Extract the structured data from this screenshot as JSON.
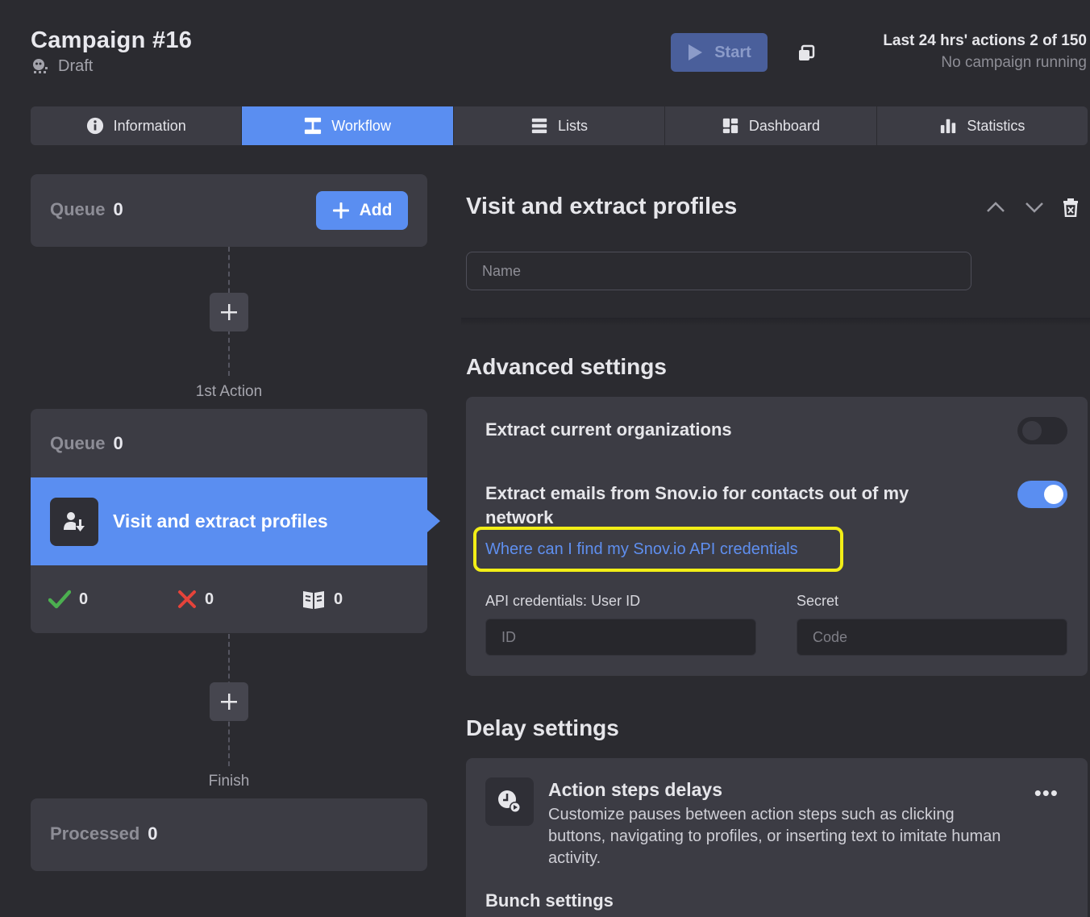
{
  "header": {
    "title": "Campaign #16",
    "status": "Draft",
    "start_label": "Start",
    "actions_stat": "Last 24 hrs' actions 2 of 150",
    "running_status": "No campaign running"
  },
  "tabs": [
    {
      "label": "Information",
      "icon": "info-icon"
    },
    {
      "label": "Workflow",
      "icon": "workflow-icon",
      "active": true
    },
    {
      "label": "Lists",
      "icon": "list-icon"
    },
    {
      "label": "Dashboard",
      "icon": "dashboard-icon"
    },
    {
      "label": "Statistics",
      "icon": "bar-chart-icon"
    }
  ],
  "workflow": {
    "top_queue": {
      "label": "Queue",
      "value": "0",
      "add_label": "Add"
    },
    "first_action_caption": "1st Action",
    "action": {
      "queue_label": "Queue",
      "queue_value": "0",
      "title": "Visit and extract profiles",
      "success_count": "0",
      "failed_count": "0",
      "skipped_count": "0"
    },
    "finish_caption": "Finish",
    "processed": {
      "label": "Processed",
      "value": "0"
    }
  },
  "detail": {
    "title": "Visit and extract profiles",
    "name_placeholder": "Name",
    "advanced_title": "Advanced settings",
    "extract_orgs_label": "Extract current organizations",
    "extract_orgs_enabled": false,
    "extract_emails_label": "Extract emails from Snov.io for contacts out of my network",
    "extract_emails_enabled": true,
    "api_link": "Where can I find my Snov.io API credentials",
    "user_id_label": "API credentials: User ID",
    "user_id_placeholder": "ID",
    "secret_label": "Secret",
    "secret_placeholder": "Code",
    "delay_title": "Delay settings",
    "action_delays_title": "Action steps delays",
    "action_delays_desc": "Customize pauses between action steps such as clicking buttons, navigating to profiles, or inserting text to imitate human activity.",
    "bunch_title": "Bunch settings"
  },
  "colors": {
    "accent": "#5a8ef1",
    "background": "#2b2b30",
    "card": "#3c3c44",
    "highlight": "#f2ee17",
    "success": "#4caf50",
    "error": "#e5433a"
  }
}
